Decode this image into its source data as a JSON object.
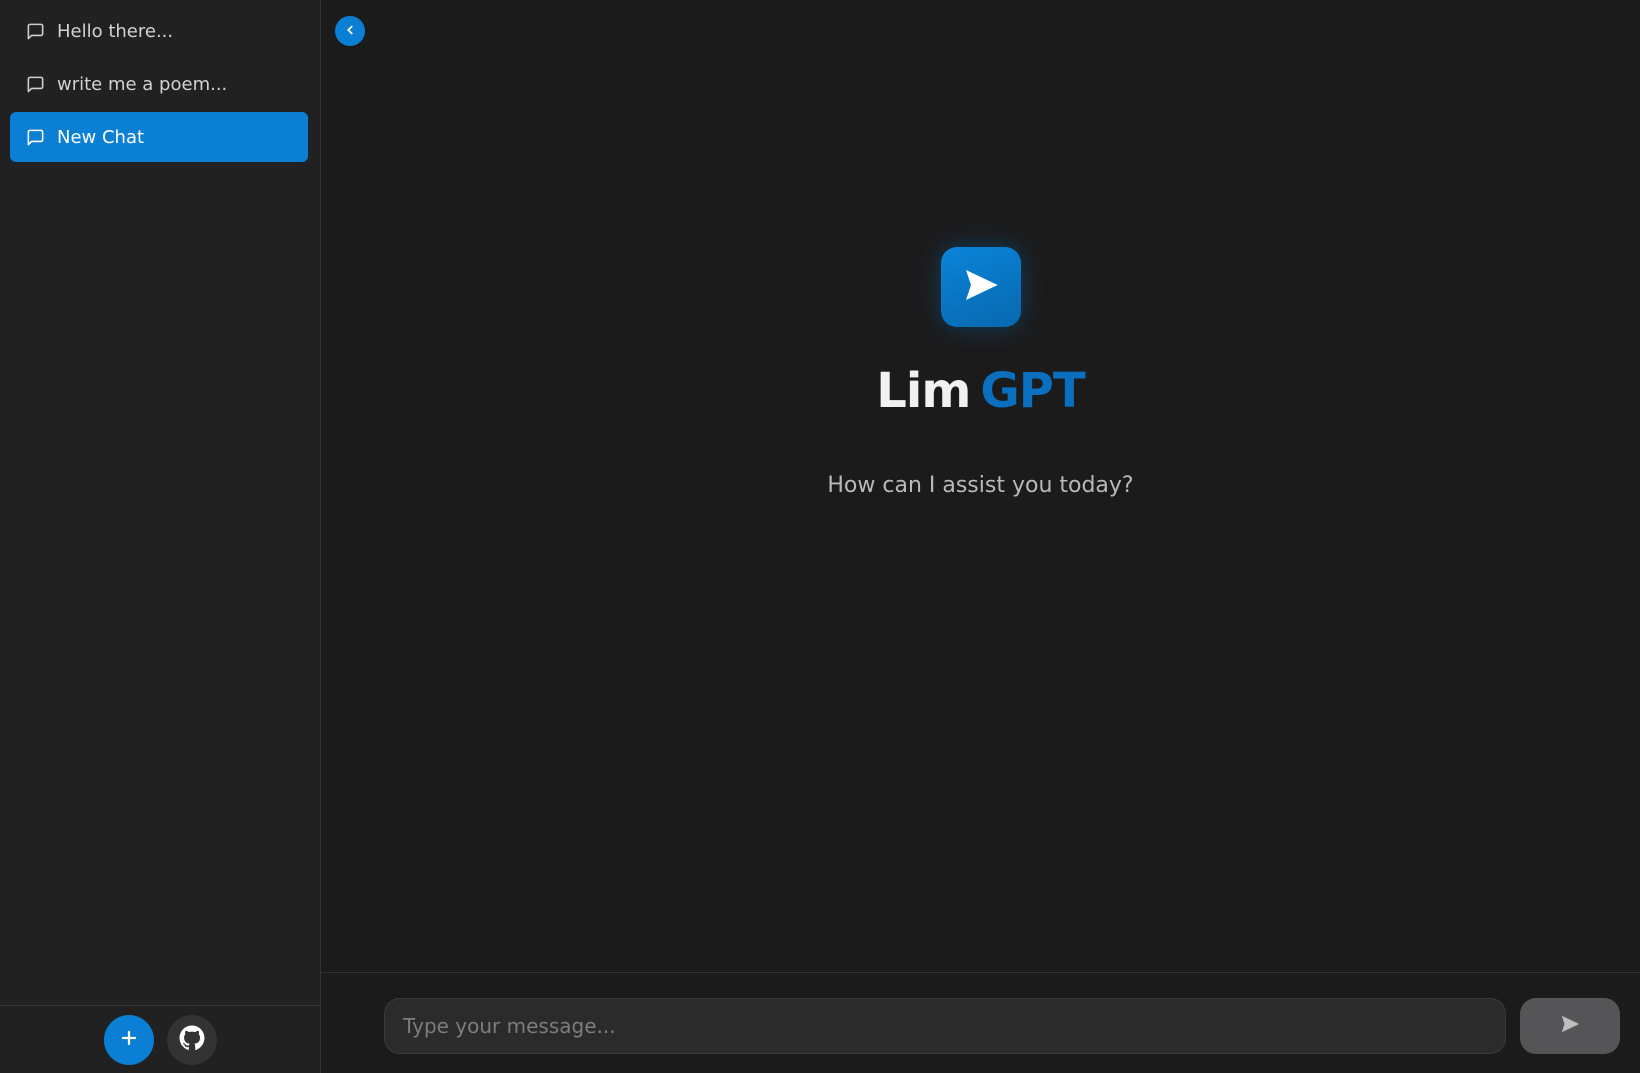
{
  "sidebar": {
    "chats": [
      {
        "label": "Hello there...",
        "active": false,
        "icon": "message-square-icon"
      },
      {
        "label": "write me a poem...",
        "active": false,
        "icon": "message-square-icon"
      },
      {
        "label": "New Chat",
        "active": true,
        "icon": "message-square-icon"
      }
    ],
    "footer": {
      "new_chat_icon": "plus-icon",
      "github_icon": "github-icon"
    }
  },
  "main": {
    "collapse_icon": "chevron-left-icon",
    "logo_icon": "send-icon",
    "brand_part1": "Lim",
    "brand_part2": "GPT",
    "subtitle": "How can I assist you today?"
  },
  "composer": {
    "placeholder": "Type your message...",
    "value": "",
    "send_icon": "send-icon"
  },
  "colors": {
    "accent": "#0a7fd4",
    "brand_blue": "#0a6fbf",
    "background": "#1b1b1c",
    "sidebar": "#212122"
  }
}
